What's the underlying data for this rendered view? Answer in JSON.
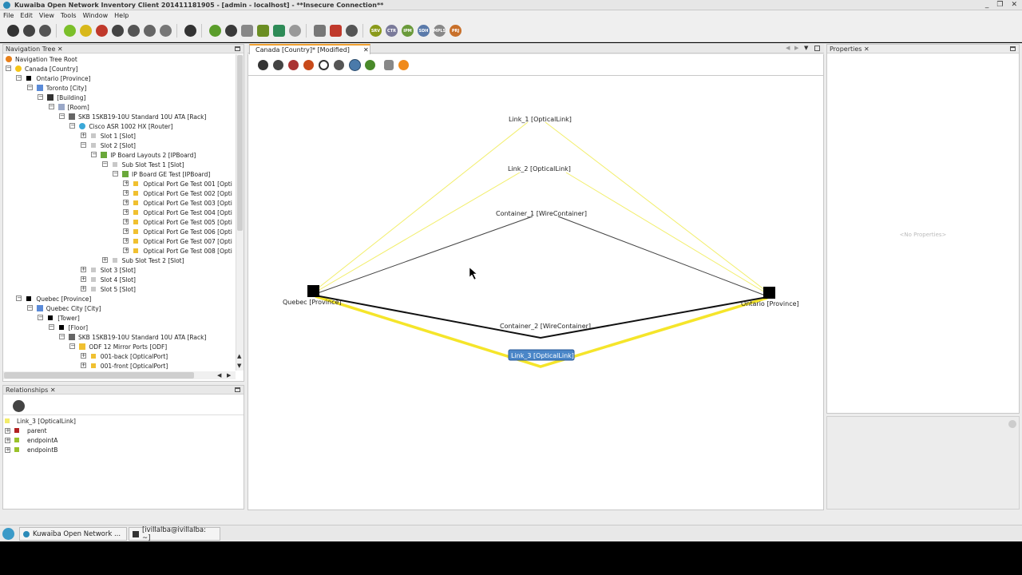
{
  "window": {
    "title": "Kuwaiba Open Network Inventory Client 201411181905 - [admin - localhost] - **Insecure Connection**",
    "controls": [
      "_",
      "❐",
      "✕"
    ]
  },
  "menu": [
    "File",
    "Edit",
    "View",
    "Tools",
    "Window",
    "Help"
  ],
  "toolbar_text_buttons": [
    "SRV",
    "CTR",
    "IPM",
    "SDH",
    "MPLS",
    "PRJ"
  ],
  "nav_tree": {
    "tab_label": "Navigation Tree",
    "close": "✕",
    "items": [
      {
        "label": "Navigation Tree Root",
        "icon": "star-icon"
      },
      {
        "label": "Canada [Country]",
        "icon": "bulb-icon"
      },
      {
        "label": "Ontario [Province]",
        "icon": "square-icon"
      },
      {
        "label": "Toronto [City]",
        "icon": "city-icon"
      },
      {
        "label": "[Building]",
        "icon": "building-icon"
      },
      {
        "label": "[Room]",
        "icon": "room-icon"
      },
      {
        "label": "SKB 1SKB19-10U Standard 10U ATA [Rack]",
        "icon": "rack-icon"
      },
      {
        "label": "Cisco ASR 1002 HX [Router]",
        "icon": "router-icon"
      },
      {
        "label": "Slot 1 [Slot]",
        "icon": "slot-icon"
      },
      {
        "label": "Slot 2 [Slot]",
        "icon": "slot-icon"
      },
      {
        "label": "IP Board Layouts 2 [IPBoard]",
        "icon": "board-icon"
      },
      {
        "label": "Sub Slot Test 1 [Slot]",
        "icon": "slot-icon"
      },
      {
        "label": "IP Board GE Test [IPBoard]",
        "icon": "board-icon"
      },
      {
        "label": "Optical Port Ge Test 001 [Opti",
        "icon": "port-icon"
      },
      {
        "label": "Optical Port Ge Test 002 [Opti",
        "icon": "port-icon"
      },
      {
        "label": "Optical Port Ge Test 003 [Opti",
        "icon": "port-icon"
      },
      {
        "label": "Optical Port Ge Test 004 [Opti",
        "icon": "port-icon"
      },
      {
        "label": "Optical Port Ge Test 005 [Opti",
        "icon": "port-icon"
      },
      {
        "label": "Optical Port Ge Test 006 [Opti",
        "icon": "port-icon"
      },
      {
        "label": "Optical Port Ge Test 007 [Opti",
        "icon": "port-icon"
      },
      {
        "label": "Optical Port Ge Test 008 [Opti",
        "icon": "port-icon"
      },
      {
        "label": "Sub Slot Test 2 [Slot]",
        "icon": "slot-icon"
      },
      {
        "label": "Slot 3 [Slot]",
        "icon": "slot-icon"
      },
      {
        "label": "Slot 4 [Slot]",
        "icon": "slot-icon"
      },
      {
        "label": "Slot 5 [Slot]",
        "icon": "slot-icon"
      },
      {
        "label": "Quebec [Province]",
        "icon": "square-icon"
      },
      {
        "label": "Quebec City [City]",
        "icon": "city-icon"
      },
      {
        "label": "[Tower]",
        "icon": "square-icon"
      },
      {
        "label": "[Floor]",
        "icon": "square-icon"
      },
      {
        "label": "SKB 1SKB19-10U Standard 10U ATA [Rack]",
        "icon": "rack-icon"
      },
      {
        "label": "ODF 12 Mirror Ports [ODF]",
        "icon": "odf-icon"
      },
      {
        "label": "001-back [OpticalPort]",
        "icon": "port-icon"
      },
      {
        "label": "001-front [OpticalPort]",
        "icon": "port-icon"
      }
    ]
  },
  "relationships": {
    "tab_label": "Relationships",
    "close": "✕",
    "root": "Link_3 [OpticalLink]",
    "children": [
      "parent",
      "endpointA",
      "endpointB"
    ]
  },
  "editor": {
    "tab_label": "Canada [Country]* [Modified]",
    "close": "✕",
    "nodes": [
      {
        "label": "Quebec [Province]"
      },
      {
        "label": "Ontario [Province]"
      }
    ],
    "links": [
      {
        "label": "Link_1 [OpticalLink]"
      },
      {
        "label": "Link_2 [OpticalLink]"
      },
      {
        "label": "Container_1 [WireContainer]"
      },
      {
        "label": "Container_2 [WireContainer]"
      },
      {
        "label": "Link_3 [OpticalLink]",
        "selected": true
      }
    ],
    "colors": {
      "optical": "#f2ee6a",
      "selected_optical": "#f5e52a",
      "container": "#222222",
      "selection": "#4a86c8"
    }
  },
  "properties": {
    "tab_label": "Properties",
    "close": "✕",
    "empty_text": "<No Properties>"
  },
  "taskbar": {
    "tasks": [
      "Kuwaiba Open Network ...",
      "[ivillalba@ivillalba: ~]"
    ]
  }
}
